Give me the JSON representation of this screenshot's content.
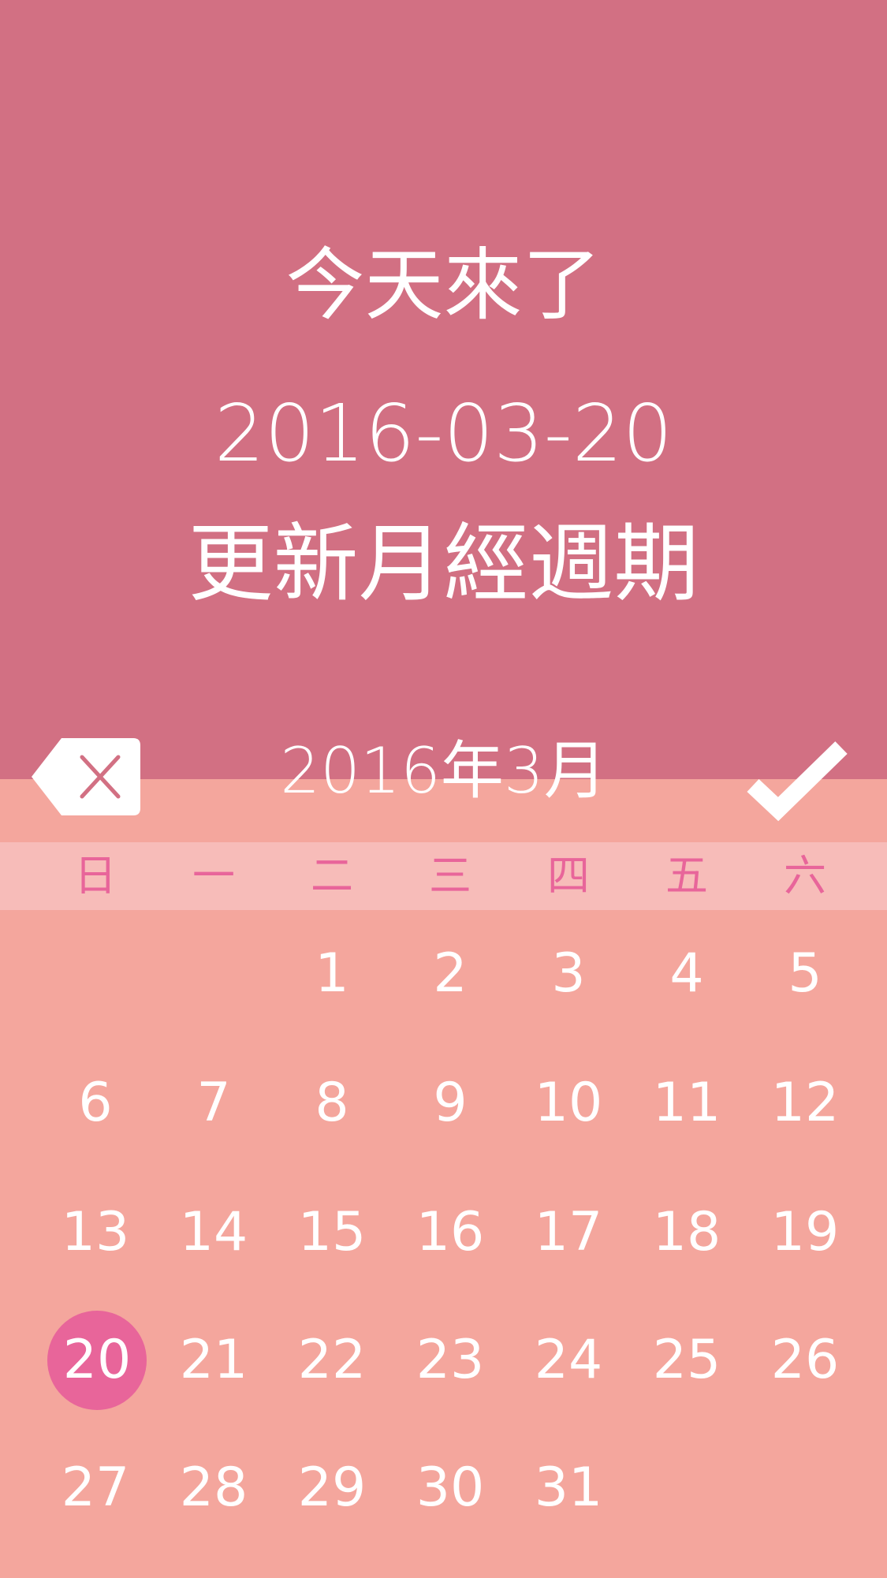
{
  "message": {
    "line1": "今天來了",
    "line2": "2016-03-20",
    "line3": "更新月經週期"
  },
  "calendar": {
    "month_title": "2016年3月",
    "weekdays": [
      "日",
      "一",
      "二",
      "三",
      "四",
      "五",
      "六"
    ],
    "weeks": [
      [
        "",
        "",
        "1",
        "2",
        "3",
        "4",
        "5"
      ],
      [
        "6",
        "7",
        "8",
        "9",
        "10",
        "11",
        "12"
      ],
      [
        "13",
        "14",
        "15",
        "16",
        "17",
        "18",
        "19"
      ],
      [
        "20",
        "21",
        "22",
        "23",
        "24",
        "25",
        "26"
      ],
      [
        "27",
        "28",
        "29",
        "30",
        "31",
        "",
        ""
      ]
    ],
    "selected_day": "20"
  },
  "icons": {
    "cancel": "backspace-x-icon",
    "confirm": "checkmark-icon"
  },
  "colors": {
    "top_background": "#d27083",
    "calendar_background": "#f4a69d",
    "weekday_bar": "#f7bcb9",
    "accent_pink": "#e8659a",
    "text": "#ffffff"
  }
}
